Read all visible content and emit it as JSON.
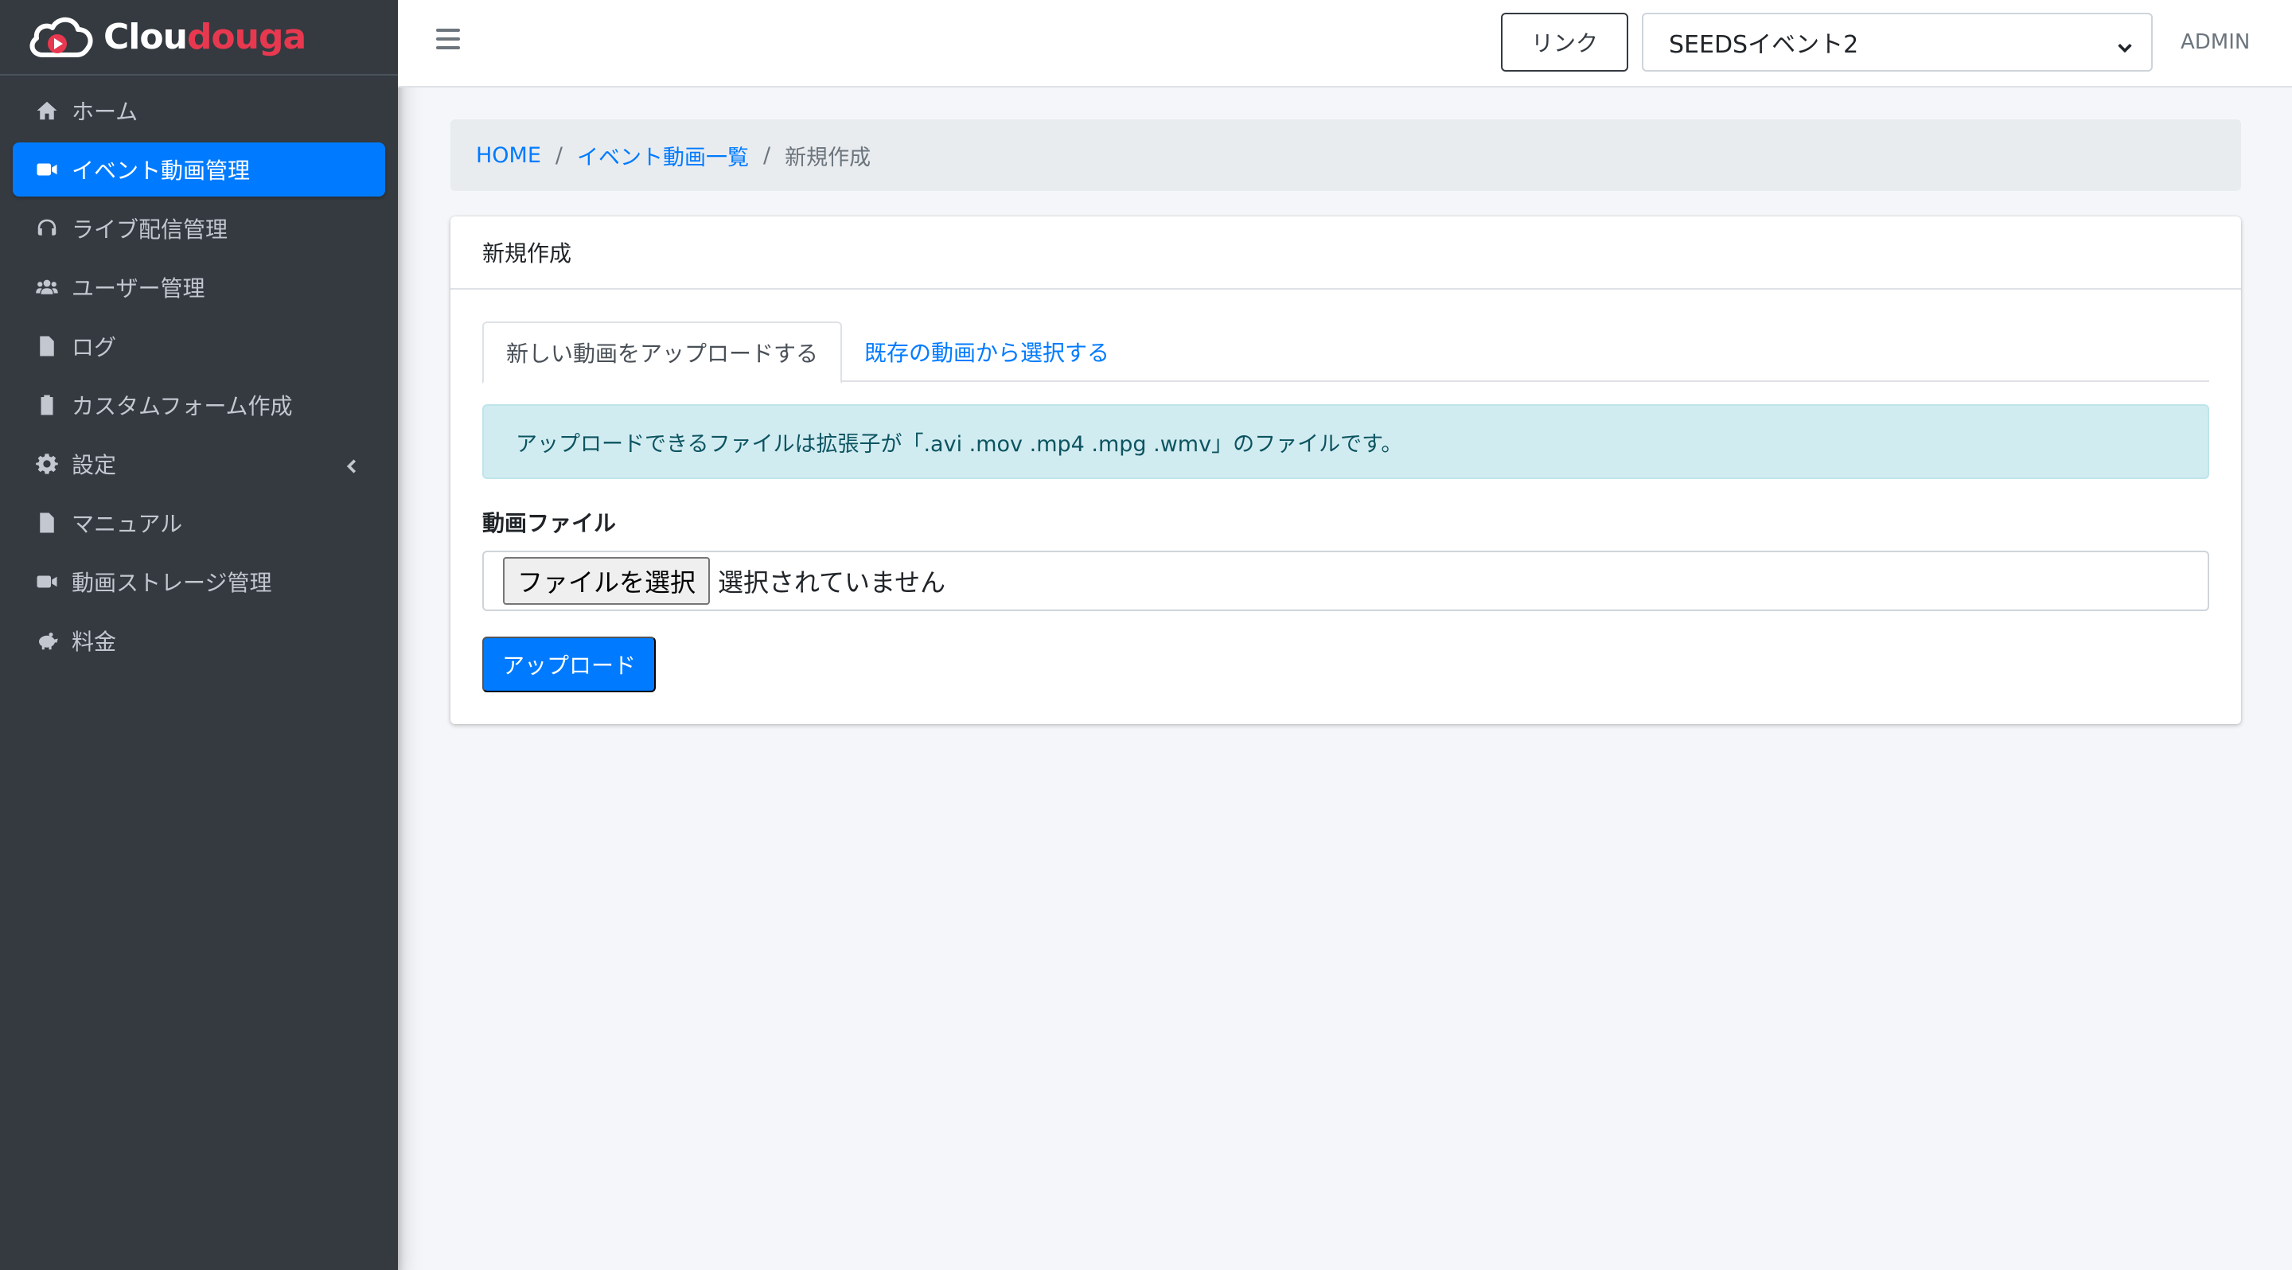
{
  "brand": {
    "name_white": "Clou",
    "name_red": "douga"
  },
  "sidebar": {
    "items": [
      {
        "label": "ホーム",
        "icon": "home-icon"
      },
      {
        "label": "イベント動画管理",
        "icon": "video-icon"
      },
      {
        "label": "ライブ配信管理",
        "icon": "headset-icon"
      },
      {
        "label": "ユーザー管理",
        "icon": "users-icon"
      },
      {
        "label": "ログ",
        "icon": "file-icon"
      },
      {
        "label": "カスタムフォーム作成",
        "icon": "clipboard-icon"
      },
      {
        "label": "設定",
        "icon": "gear-icon"
      },
      {
        "label": "マニュアル",
        "icon": "file-icon"
      },
      {
        "label": "動画ストレージ管理",
        "icon": "video-icon"
      },
      {
        "label": "料金",
        "icon": "piggy-bank-icon"
      }
    ]
  },
  "header": {
    "link_label": "リンク",
    "selected_event": "SEEDSイベント2",
    "user": "ADMIN"
  },
  "breadcrumb": {
    "home": "HOME",
    "list": "イベント動画一覧",
    "current": "新規作成"
  },
  "card": {
    "title": "新規作成",
    "tabs": {
      "upload": "新しい動画をアップロードする",
      "existing": "既存の動画から選択する"
    },
    "alert": "アップロードできるファイルは拡張子が「.avi .mov .mp4 .mpg .wmv」のファイルです。",
    "field_label": "動画ファイル",
    "file_button": "ファイルを選択",
    "file_status": "選択されていません",
    "submit": "アップロード"
  },
  "colors": {
    "accent": "#007bff",
    "sidebar_bg": "#343a40",
    "brand_red": "#e8384f",
    "alert_bg": "#d1ecf1"
  }
}
